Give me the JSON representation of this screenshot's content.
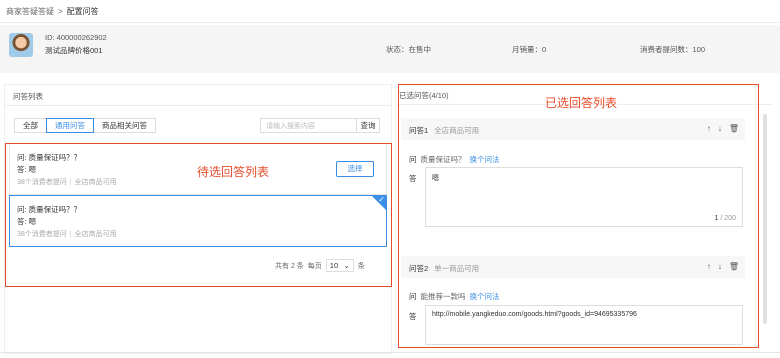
{
  "breadcrumb": {
    "parent": "商家答疑答疑",
    "sep": ">",
    "current": "配置问答"
  },
  "product": {
    "id": "ID: 400000262902",
    "name": "测试品牌价格001",
    "status": "状态：在售中",
    "sales": "月销量：0",
    "questions": "消费者提问数：100"
  },
  "left_panel": {
    "title": "问答列表",
    "tabs": [
      "全部",
      "通用问答",
      "商品相关问答"
    ],
    "active_tab": "通用问答",
    "search": {
      "placeholder": "请输入搜索内容",
      "button": "查询"
    },
    "items": [
      {
        "q": "问:  质量保证吗？？",
        "a": "答:  嗯",
        "meta_asked": "38个消费者提问",
        "meta_scope": "全店商品可用",
        "button": "选择"
      },
      {
        "q": "问:  质量保证吗？？",
        "a": "答:  嗯",
        "meta_asked": "38个消费者提问",
        "meta_scope": "全店商品可用",
        "checkmark": "✓"
      }
    ],
    "pager": {
      "total": "共有 2 条",
      "per_page_label": "每页",
      "per_page": "10",
      "unit": "条",
      "arrow": "⌄"
    },
    "annotation": "待选回答列表"
  },
  "right_panel": {
    "title": "已选问答(4/10)",
    "annotation": "已选回答列表",
    "answers": [
      {
        "label": "问答1",
        "scope": "全店商品可用",
        "q_prefix": "问",
        "q_text": "质量保证吗？",
        "switch_link": "换个问法",
        "a_prefix": "答",
        "a_text": "嗯",
        "count": "1",
        "max": "/ 200"
      },
      {
        "label": "问答2",
        "scope": "单一商品可用",
        "q_prefix": "问",
        "q_text": "能推荐一款吗",
        "switch_link": "换个问法",
        "a_prefix": "答",
        "a_text": "http://mobile.yangkeduo.com/goods.html?goods_id=94695335796"
      }
    ],
    "ops_icons": {
      "up": "↑",
      "down": "↓",
      "delete": "🗑"
    }
  },
  "colors": {
    "accent": "#3a8ee6",
    "annotation": "#e84b2a"
  }
}
